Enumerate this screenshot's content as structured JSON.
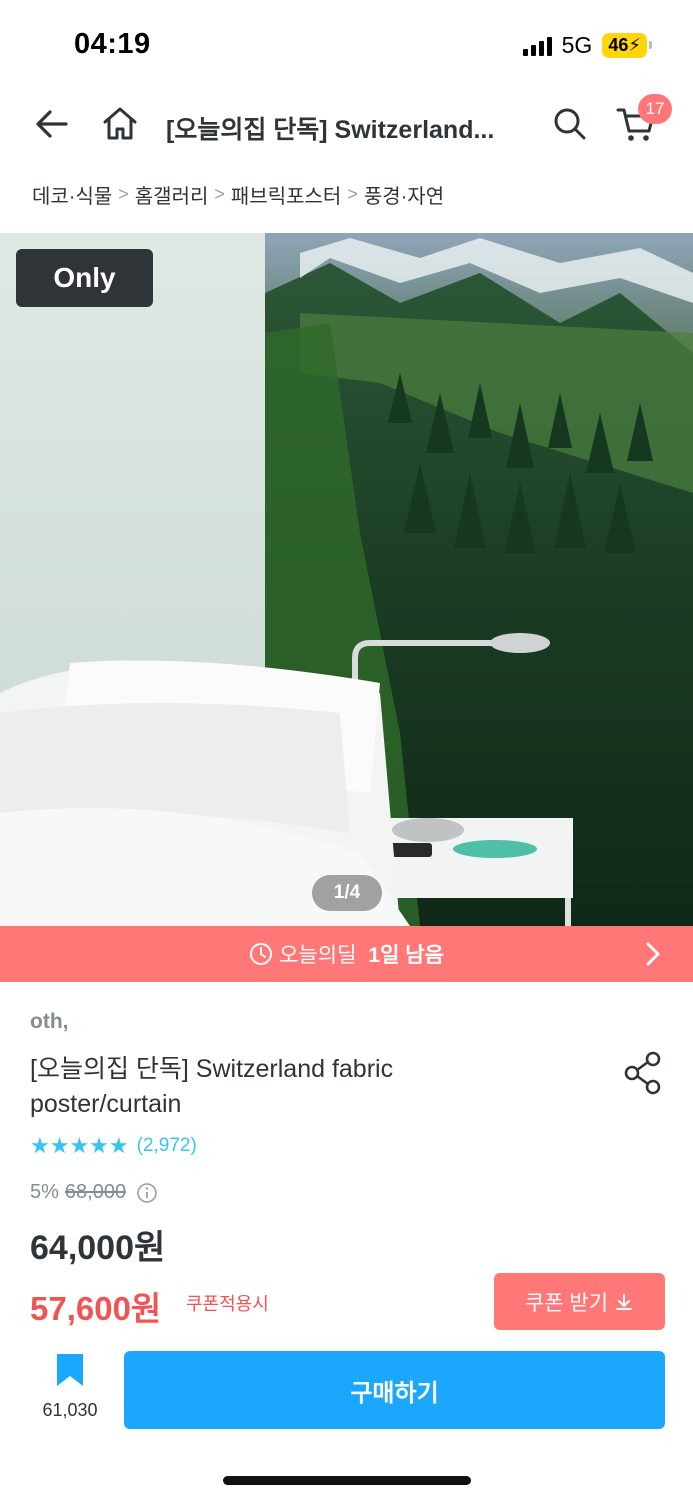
{
  "status": {
    "time": "04:19",
    "network": "5G",
    "battery": "46"
  },
  "nav": {
    "title": "[오늘의집 단독] Switzerland...",
    "cart_count": "17"
  },
  "breadcrumb": [
    "데코·식물",
    "홈갤러리",
    "패브릭포스터",
    "풍경·자연"
  ],
  "hero": {
    "badge": "Only",
    "pager": "1/4"
  },
  "deal": {
    "label": "오늘의딜",
    "remaining": "1일 남음"
  },
  "product": {
    "brand": "oth,",
    "title": "[오늘의집 단독] Switzerland fabric poster/curtain",
    "rating": 4.8,
    "review_count": "(2,972)",
    "discount": "5%",
    "original_price": "68,000",
    "sale_price": "64,000원",
    "coupon_price": "57,600원",
    "coupon_note": "쿠폰적용시",
    "coupon_button": "쿠폰 받기"
  },
  "footer": {
    "scrap_count": "61,030",
    "buy_label": "구매하기"
  },
  "colors": {
    "accent": "#35c5f0",
    "deal": "#ff7777",
    "coupon": "#f05454",
    "buy": "#1ca7ff"
  }
}
